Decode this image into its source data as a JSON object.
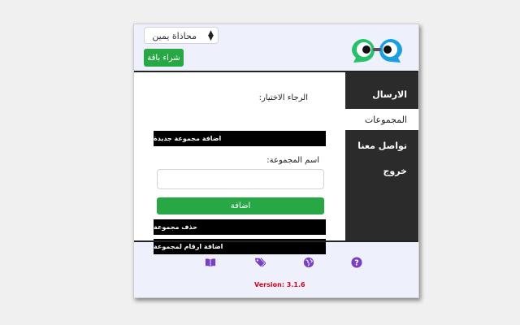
{
  "header": {
    "mode_select": {
      "value": "محاذاة يمين",
      "arrow": "⬍"
    },
    "buy_button": "شراء باقة",
    "logo_icon": "chat-eyes-logo-icon"
  },
  "sidebar": {
    "items": [
      {
        "label": "الارسال",
        "active": false
      },
      {
        "label": "المجموعات",
        "active": true
      },
      {
        "label": "تواصل معنا",
        "active": false
      },
      {
        "label": "خروج",
        "active": false
      }
    ]
  },
  "main": {
    "choose_label": "الرجاء الاختيار:",
    "add_new_group": "اضافة مجموعة جديدة",
    "group_name_label": "اسم المجموعة:",
    "group_name_value": "",
    "add_button": "اضافة",
    "delete_group": "حذف مجموعة",
    "add_numbers": "اضافة ارقام لمجموعة"
  },
  "footer": {
    "icons": [
      "book-icon",
      "tags-icon",
      "globe-icon",
      "help-icon"
    ],
    "icon_color": "#7b3fc4",
    "version": "Version: 3.1.6"
  },
  "colors": {
    "green": "#28a745",
    "sidebar_bg": "#2b2b2b",
    "version_red": "#d0021b",
    "logo_green": "#27c06b",
    "logo_blue": "#1a9fe0"
  }
}
